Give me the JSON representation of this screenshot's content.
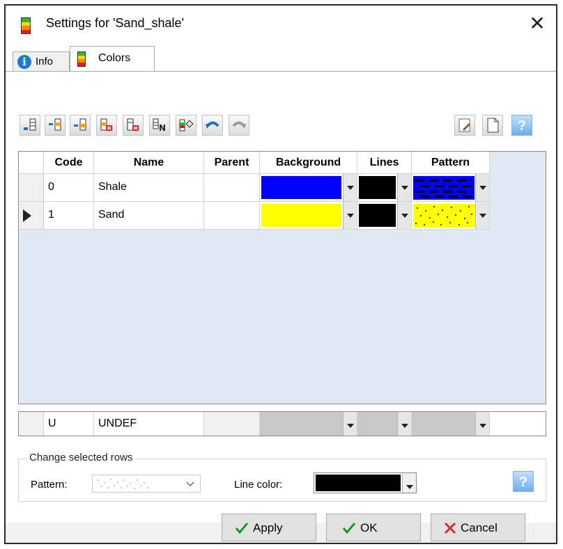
{
  "window": {
    "title": "Settings for 'Sand_shale'",
    "close_glyph": "✕"
  },
  "tabs": [
    {
      "label": "Info",
      "icon": "info-icon",
      "selected": false
    },
    {
      "label": "Colors",
      "icon": "color-bars-icon",
      "selected": true
    }
  ],
  "toolbar": {
    "buttons": [
      {
        "name": "insert-row-after-button",
        "icon": "insert-row-after-icon",
        "enabled": true
      },
      {
        "name": "insert-row-before-button",
        "icon": "insert-row-before-icon",
        "enabled": true
      },
      {
        "name": "insert-row-button",
        "icon": "insert-row-icon",
        "enabled": true
      },
      {
        "name": "delete-row-button",
        "icon": "delete-row-icon",
        "enabled": true
      },
      {
        "name": "delete-all-rows-button",
        "icon": "delete-all-rows-icon",
        "enabled": true
      },
      {
        "name": "numbering-button",
        "icon": "numbering-icon",
        "enabled": true
      },
      {
        "name": "fill-color-button",
        "icon": "paint-bucket-icon",
        "enabled": true
      },
      {
        "name": "undo-button",
        "icon": "undo-icon",
        "enabled": true
      },
      {
        "name": "redo-button",
        "icon": "redo-icon",
        "enabled": false
      }
    ],
    "right_buttons": [
      {
        "name": "edit-button",
        "icon": "edit-document-icon"
      },
      {
        "name": "new-document-button",
        "icon": "new-document-icon"
      },
      {
        "name": "help-button",
        "icon": "help-icon",
        "glyph": "?"
      }
    ]
  },
  "grid": {
    "headers": {
      "code": "Code",
      "name": "Name",
      "parent": "Parent",
      "background": "Background",
      "lines": "Lines",
      "pattern": "Pattern"
    },
    "rows": [
      {
        "code": "0",
        "name": "Shale",
        "parent": "",
        "background": "#0000ff",
        "lines": "#000000",
        "pattern": "shale-dashes",
        "selected": false
      },
      {
        "code": "1",
        "name": "Sand",
        "parent": "",
        "background": "#ffff00",
        "lines": "#000000",
        "pattern": "sand-dots",
        "selected": true
      }
    ],
    "undefined_row": {
      "code": "U",
      "name": "UNDEF"
    }
  },
  "change_selected": {
    "legend": "Change selected rows",
    "pattern_label": "Pattern:",
    "pattern_value": "sand-dots",
    "line_color_label": "Line color:",
    "line_color": "#000000",
    "help_glyph": "?"
  },
  "footer": {
    "apply_label": "Apply",
    "ok_label": "OK",
    "cancel_label": "Cancel",
    "check_color": "#1a9a1a",
    "cancel_color": "#d32f2f"
  }
}
